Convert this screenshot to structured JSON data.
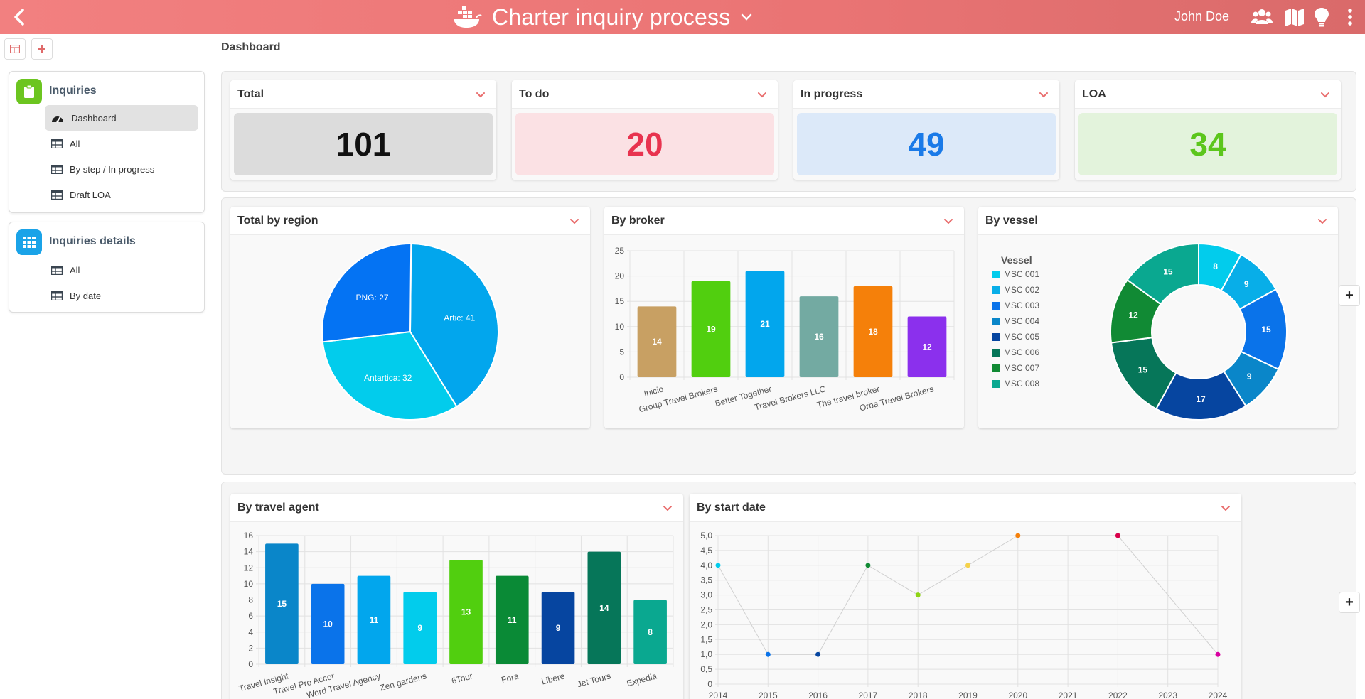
{
  "header": {
    "title": "Charter inquiry process",
    "user": "John Doe",
    "icons": [
      "back-arrow-icon",
      "ship-logo-icon",
      "chevron-down-icon",
      "users-icon",
      "map-icon",
      "lightbulb-icon",
      "more-vertical-icon"
    ]
  },
  "sidebar": {
    "groups": [
      {
        "title": "Inquiries",
        "color": "#6cc520",
        "items": [
          "Dashboard",
          "All",
          "By step / In progress",
          "Draft LOA"
        ],
        "active": 0
      },
      {
        "title": "Inquiries details",
        "color": "#1aa3e8",
        "items": [
          "All",
          "By date"
        ]
      }
    ]
  },
  "breadcrumb": "Dashboard",
  "kpis": [
    {
      "title": "Total",
      "value": "101",
      "bg": "#dcdcdc",
      "color": "#111111"
    },
    {
      "title": "To do",
      "value": "20",
      "bg": "#fbe1e4",
      "color": "#e8334f"
    },
    {
      "title": "In progress",
      "value": "49",
      "bg": "#dce9f9",
      "color": "#1a7ae8"
    },
    {
      "title": "LOA",
      "value": "34",
      "bg": "#e3f3dc",
      "color": "#5cc61c"
    }
  ],
  "cards": {
    "region": "Total by region",
    "broker": "By broker",
    "vessel": "By vessel",
    "agent": "By travel agent",
    "startdate": "By start date"
  },
  "chart_data": [
    {
      "type": "pie",
      "title": "Total by region",
      "slices": [
        {
          "label": "Artic",
          "value": 41,
          "color": "#02a6ed"
        },
        {
          "label": "Antartica",
          "value": 32,
          "color": "#02ccec"
        },
        {
          "label": "PNG",
          "value": 27,
          "color": "#0473f3"
        }
      ]
    },
    {
      "type": "bar",
      "title": "By broker",
      "categories": [
        "Inicio",
        "Group Travel Brokers",
        "Better Together",
        "Travel Brokers LLC",
        "The travel broker",
        "Orba Travel Brokers"
      ],
      "values": [
        14,
        19,
        21,
        16,
        18,
        12
      ],
      "colors": [
        "#c8a063",
        "#51cf0f",
        "#02a6ed",
        "#73aaa2",
        "#f5800a",
        "#8b30ed"
      ],
      "ylim": [
        0,
        25
      ],
      "yticks": [
        0,
        5,
        10,
        15,
        20,
        25
      ]
    },
    {
      "type": "donut",
      "title": "By vessel",
      "legend_title": "Vessel",
      "legend_position": "left",
      "labels": [
        "MSC 001",
        "MSC 002",
        "MSC 003",
        "MSC 004",
        "MSC 005",
        "MSC 006",
        "MSC 007",
        "MSC 008"
      ],
      "values": [
        8,
        9,
        15,
        9,
        17,
        15,
        12,
        15
      ],
      "colors": [
        "#02ccec",
        "#08aee8",
        "#0a73ea",
        "#0a86c9",
        "#0645a0",
        "#067659",
        "#118a34",
        "#0aa890"
      ]
    },
    {
      "type": "bar",
      "title": "By travel agent",
      "categories": [
        "Travel Insight",
        "Travel Pro Accor",
        "Word Travel Agency",
        "Zen gardens",
        "6Tour",
        "Fora",
        "Libere",
        "Jet Tours",
        "Expedia"
      ],
      "values": [
        15,
        10,
        11,
        9,
        13,
        11,
        9,
        14,
        8
      ],
      "colors": [
        "#0a86c9",
        "#0a73ea",
        "#02a6ed",
        "#02ccec",
        "#51cf0f",
        "#0a8a36",
        "#0645a0",
        "#067659",
        "#0aa890"
      ],
      "ylim": [
        0,
        16
      ],
      "yticks": [
        0,
        2,
        4,
        6,
        8,
        10,
        12,
        14,
        16
      ]
    },
    {
      "type": "line",
      "title": "By start date",
      "x": [
        2014,
        2015,
        2016,
        2017,
        2018,
        2019,
        2020,
        2022,
        2024
      ],
      "y": [
        4,
        1,
        1,
        4,
        3,
        4,
        5,
        5,
        1
      ],
      "point_colors": [
        "#02ccec",
        "#0a73ea",
        "#0645a0",
        "#118a34",
        "#8ed414",
        "#f5d24a",
        "#f5800a",
        "#d8004a",
        "#d800a0"
      ],
      "xticks": [
        2014,
        2015,
        2016,
        2017,
        2018,
        2019,
        2020,
        2021,
        2022,
        2023,
        2024
      ],
      "ylim": [
        0,
        5
      ],
      "yticks": [
        "0",
        "0,5",
        "1,0",
        "1,5",
        "2,0",
        "2,5",
        "3,0",
        "3,5",
        "4,0",
        "4,5",
        "5,0"
      ]
    }
  ]
}
